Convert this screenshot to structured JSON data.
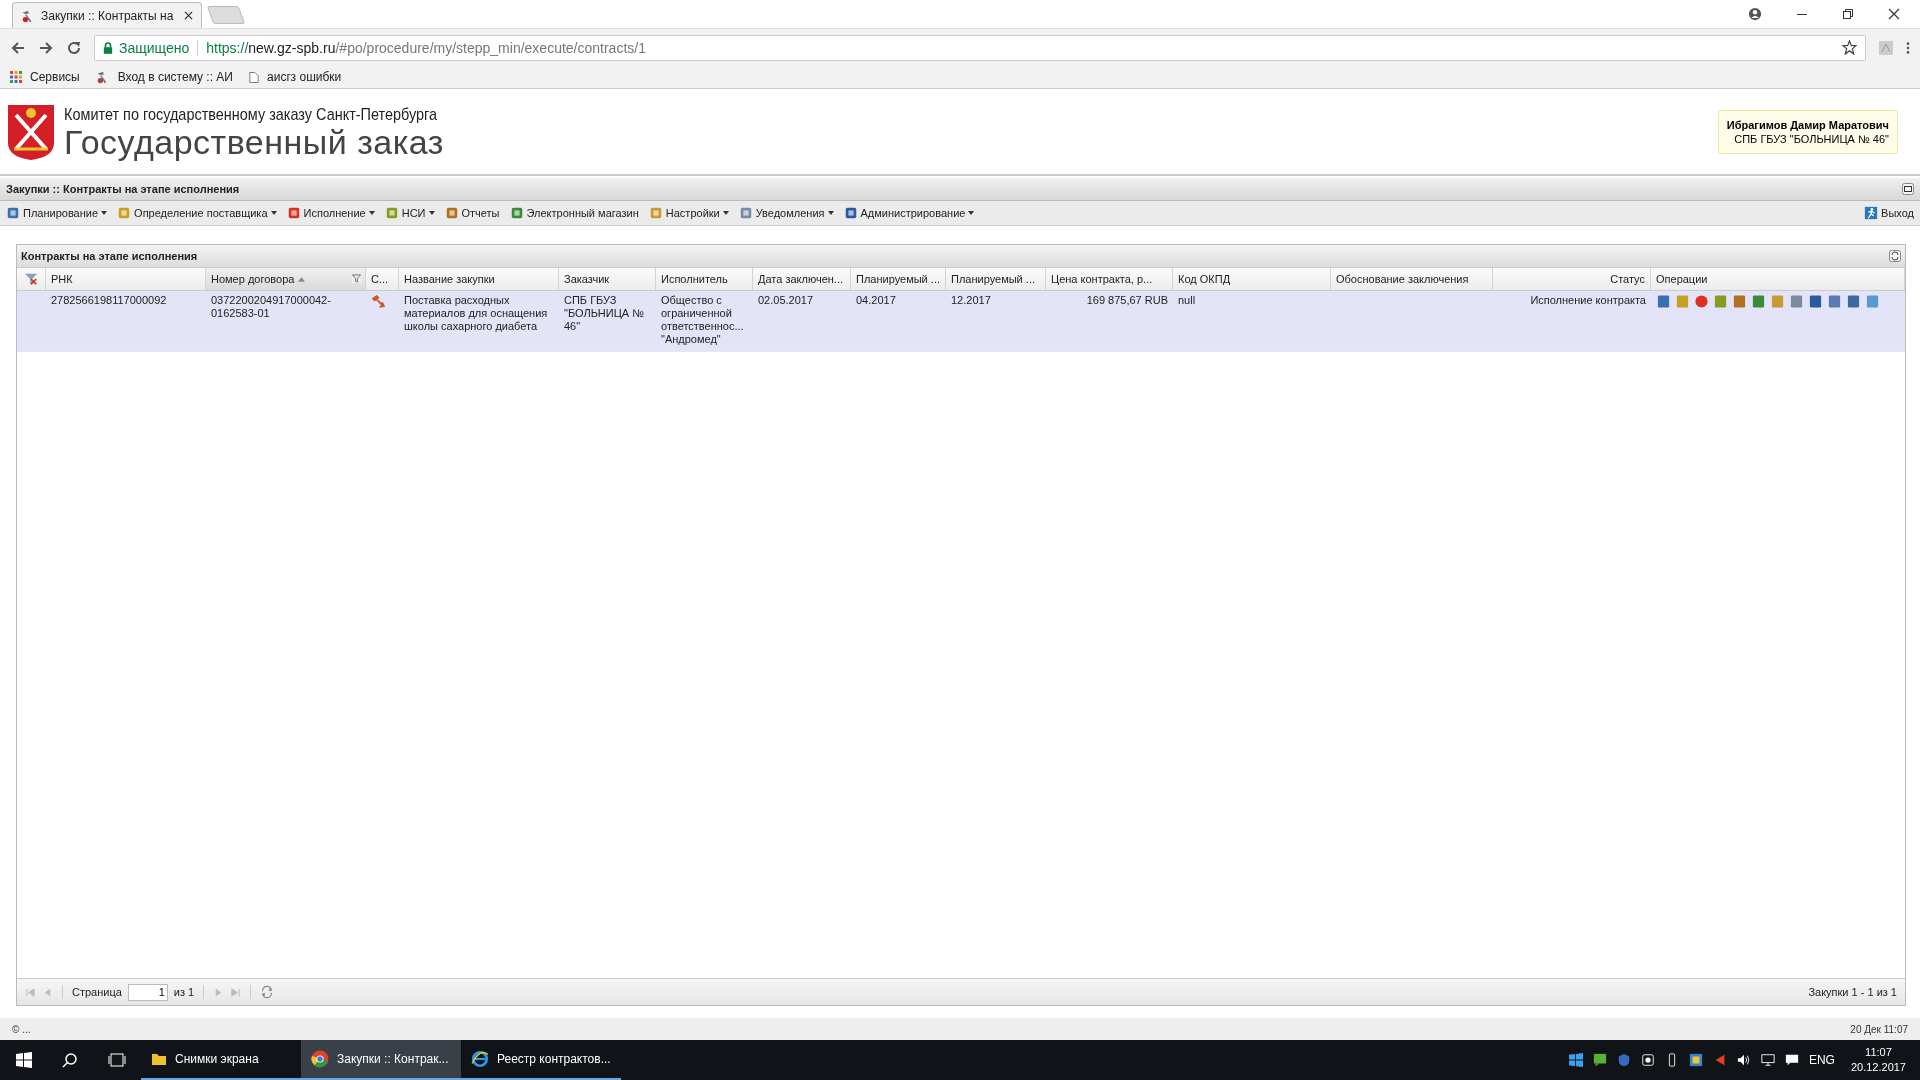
{
  "browser": {
    "tab_title": "Закупки :: Контракты на",
    "secure_label": "Защищено",
    "url_scheme": "https://",
    "url_host": "new.gz-spb.ru",
    "url_path": "/#po/procedure/my/stepp_min/execute/contracts/1",
    "bookmarks": [
      {
        "label": "Сервисы",
        "kind": "apps"
      },
      {
        "label": "Вход в систему :: АИ",
        "kind": "site"
      },
      {
        "label": "аисгз ошибки",
        "kind": "page"
      }
    ]
  },
  "header": {
    "subtitle": "Комитет по государственному заказу Санкт-Петербурга",
    "title": "Государственный заказ",
    "user_name": "Ибрагимов Дамир Маратович",
    "user_org": "СПБ ГБУЗ \"БОЛЬНИЦА № 46\""
  },
  "page_title": "Закупки :: Контракты на этапе исполнения",
  "menu": [
    {
      "label": "Планирование",
      "dropdown": true
    },
    {
      "label": "Определение поставщика",
      "dropdown": true
    },
    {
      "label": "Исполнение",
      "dropdown": true
    },
    {
      "label": "НСИ",
      "dropdown": true
    },
    {
      "label": "Отчеты",
      "dropdown": false
    },
    {
      "label": "Электронный магазин",
      "dropdown": false
    },
    {
      "label": "Настройки",
      "dropdown": true
    },
    {
      "label": "Уведомления",
      "dropdown": true
    },
    {
      "label": "Администрирование",
      "dropdown": true
    }
  ],
  "logout": "Выход",
  "grid": {
    "title": "Контракты на этапе исполнения",
    "columns": [
      {
        "label": "РНК",
        "sorted": false,
        "filtered": false
      },
      {
        "label": "Номер договора",
        "sorted": true,
        "filtered": true
      },
      {
        "label": "С...",
        "sorted": false,
        "filtered": false
      },
      {
        "label": "Название закупки",
        "sorted": false,
        "filtered": false
      },
      {
        "label": "Заказчик",
        "sorted": false,
        "filtered": false
      },
      {
        "label": "Исполнитель",
        "sorted": false,
        "filtered": false
      },
      {
        "label": "Дата заключен...",
        "sorted": false,
        "filtered": false
      },
      {
        "label": "Планируемый ...",
        "sorted": false,
        "filtered": false
      },
      {
        "label": "Планируемый ...",
        "sorted": false,
        "filtered": false
      },
      {
        "label": "Цена контракта, р...",
        "sorted": false,
        "filtered": false
      },
      {
        "label": "Код ОКПД",
        "sorted": false,
        "filtered": false
      },
      {
        "label": "Обоснование заключения",
        "sorted": false,
        "filtered": false
      },
      {
        "label": "Статус",
        "sorted": false,
        "filtered": false
      },
      {
        "label": "Операции",
        "sorted": false,
        "filtered": false
      }
    ],
    "rows": [
      {
        "selected": true,
        "rnk": "2782566198117000092",
        "number": "0372200204917000042-0162583-01",
        "name": "Поставка расходных материалов для оснащения школы сахарного диабета",
        "customer": "СПБ ГБУЗ \"БОЛЬНИЦА № 46\"",
        "supplier": "Общество с ограниченной ответственнос... \"Андромед\"",
        "date": "02.05.2017",
        "planned_start": "04.2017",
        "planned_end": "12.2017",
        "price": "169 875,67 RUB",
        "okpd": "null",
        "status": "Исполнение контракта"
      }
    ]
  },
  "pager": {
    "page_label": "Страница",
    "page": "1",
    "of": "из 1",
    "summary": "Закупки 1 - 1 из 1"
  },
  "status_bar": {
    "left": "© ...",
    "right": "20 Дек 11:07"
  },
  "taskbar": {
    "apps": [
      {
        "label": "Снимки экрана",
        "kind": "folder",
        "selected": false
      },
      {
        "label": "Закупки :: Контрак...",
        "kind": "chrome",
        "selected": true
      },
      {
        "label": "Реестр контрактов...",
        "kind": "ie",
        "selected": false
      }
    ],
    "language": "ENG",
    "time": "11:07",
    "date": "20.12.2017"
  }
}
